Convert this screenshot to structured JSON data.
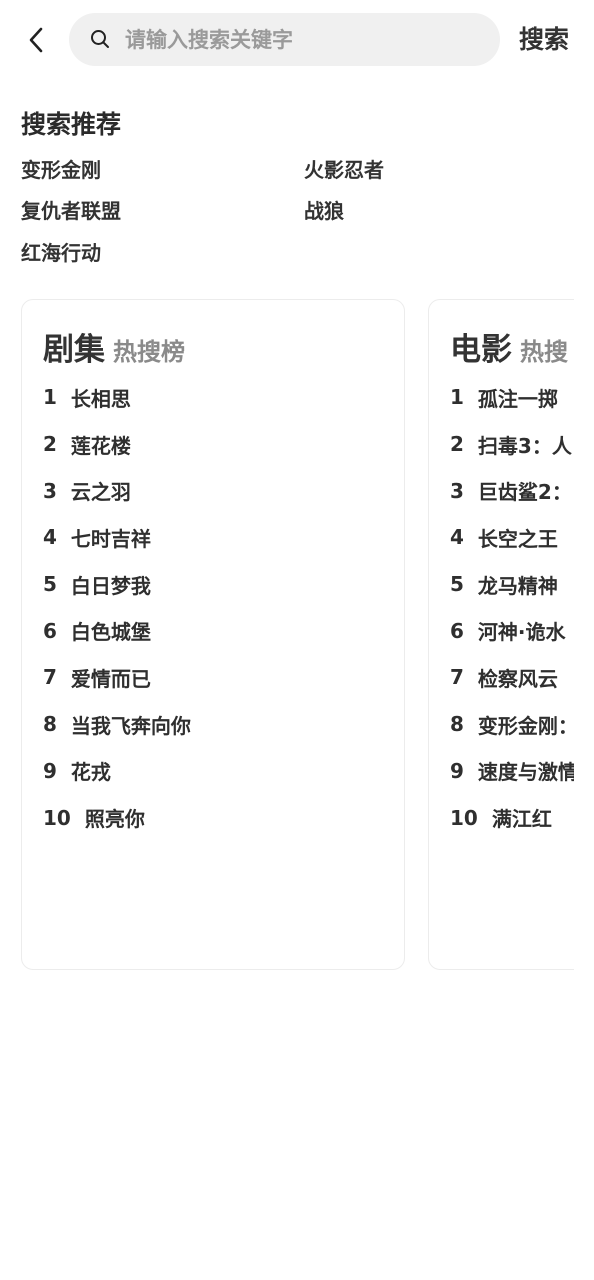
{
  "header": {
    "search_placeholder": "请输入搜索关键字",
    "search_button": "搜索"
  },
  "recommend": {
    "title": "搜索推荐",
    "items": [
      "变形金刚",
      "火影忍者",
      "复仇者联盟",
      "战狼",
      "红海行动"
    ]
  },
  "rank_tabs": [
    {
      "category": "剧集",
      "subtitle": "热搜榜",
      "items": [
        {
          "rank": "1",
          "name": "长相思"
        },
        {
          "rank": "2",
          "name": "莲花楼"
        },
        {
          "rank": "3",
          "name": "云之羽"
        },
        {
          "rank": "4",
          "name": "七时吉祥"
        },
        {
          "rank": "5",
          "name": "白日梦我"
        },
        {
          "rank": "6",
          "name": "白色城堡"
        },
        {
          "rank": "7",
          "name": "爱情而已"
        },
        {
          "rank": "8",
          "name": "当我飞奔向你"
        },
        {
          "rank": "9",
          "name": "花戎"
        },
        {
          "rank": "10",
          "name": "照亮你"
        }
      ]
    },
    {
      "category": "电影",
      "subtitle": "热搜",
      "items": [
        {
          "rank": "1",
          "name": "孤注一掷"
        },
        {
          "rank": "2",
          "name": "扫毒3：人"
        },
        {
          "rank": "3",
          "name": "巨齿鲨2："
        },
        {
          "rank": "4",
          "name": "长空之王"
        },
        {
          "rank": "5",
          "name": "龙马精神"
        },
        {
          "rank": "6",
          "name": "河神·诡水"
        },
        {
          "rank": "7",
          "name": "检察风云"
        },
        {
          "rank": "8",
          "name": "变形金刚："
        },
        {
          "rank": "9",
          "name": "速度与激情"
        },
        {
          "rank": "10",
          "name": "满江红"
        }
      ]
    }
  ]
}
